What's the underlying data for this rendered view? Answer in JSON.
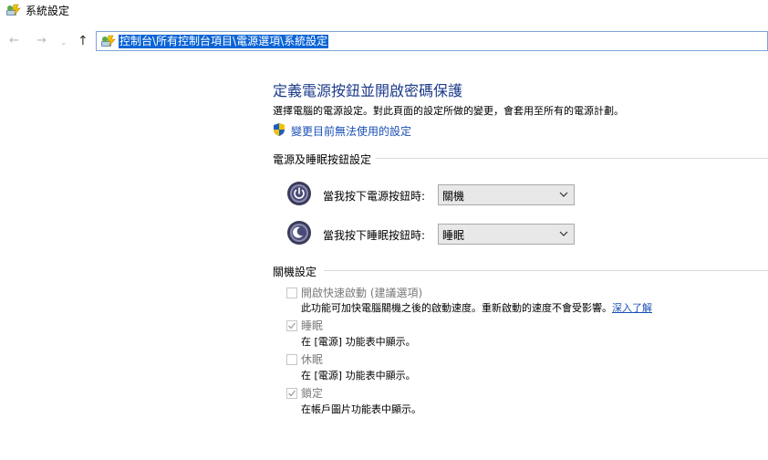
{
  "window": {
    "title": "系統設定",
    "icon": "power-options-icon"
  },
  "nav": {
    "back_icon": "back-arrow-icon",
    "forward_icon": "forward-arrow-icon",
    "recent_icon": "chevron-down-icon",
    "up_icon": "up-arrow-icon"
  },
  "address": {
    "path": "控制台\\所有控制台項目\\電源選項\\系統設定",
    "highlight_color": "#0a64d6"
  },
  "page": {
    "title": "定義電源按鈕並開啟密碼保護",
    "description": "選擇電腦的電源設定。對此頁面的設定所做的變更，會套用至所有的電源計劃。",
    "change_link": "變更目前無法使用的設定",
    "title_color": "#1b3a8a",
    "link_color": "#1a4fb5"
  },
  "power_buttons": {
    "section_title": "電源及睡眠按鈕設定",
    "rows": [
      {
        "label": "當我按下電源按鈕時:",
        "value": "關機",
        "icon": "power-button-icon"
      },
      {
        "label": "當我按下睡眠按鈕時:",
        "value": "睡眠",
        "icon": "sleep-button-icon"
      }
    ]
  },
  "shutdown": {
    "section_title": "關機設定",
    "options": [
      {
        "label": "開啟快速啟動 (建議選項)",
        "checked": false,
        "description": "此功能可加快電腦關機之後的啟動速度。重新啟動的速度不會受影響。",
        "link": "深入了解"
      },
      {
        "label": "睡眠",
        "checked": true,
        "description": "在 [電源] 功能表中顯示。"
      },
      {
        "label": "休眠",
        "checked": false,
        "description": "在 [電源] 功能表中顯示。"
      },
      {
        "label": "鎖定",
        "checked": true,
        "description": "在帳戶圖片功能表中顯示。"
      }
    ]
  }
}
